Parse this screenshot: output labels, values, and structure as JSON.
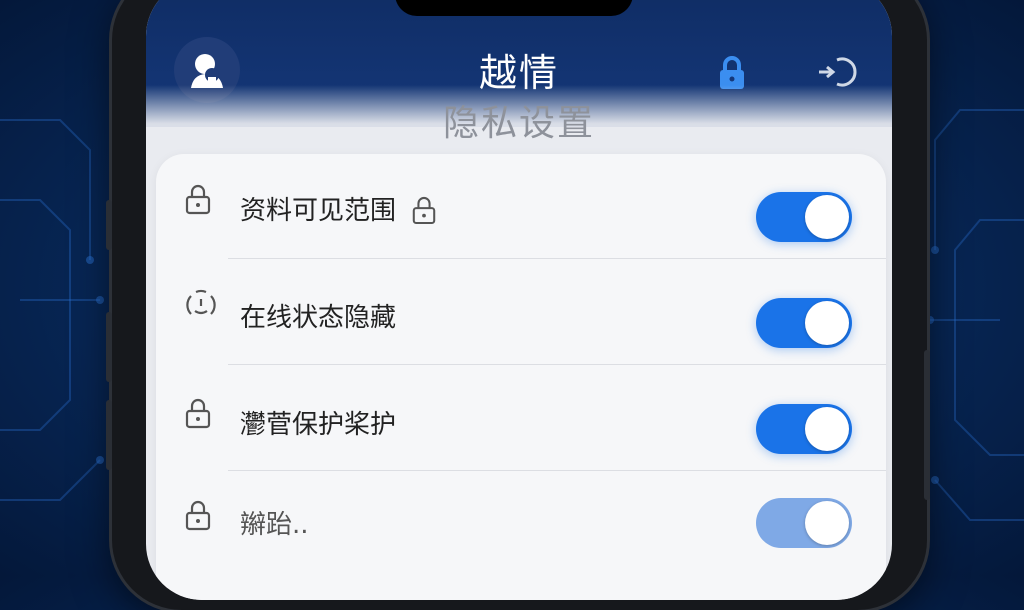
{
  "header": {
    "title": "越情",
    "subtitle": "隐私设置",
    "avatar_icon": "user-avatar-icon",
    "lock_icon": "lock-icon",
    "back_icon": "back-icon"
  },
  "settings": {
    "items": [
      {
        "label": "资料可见范围",
        "icon": "lock-icon",
        "trailing_icon": "lock-icon",
        "enabled": true
      },
      {
        "label": "在线状态隐藏",
        "icon": "face-icon",
        "enabled": true
      },
      {
        "label": "灪菅保护桨护",
        "icon": "lock-icon",
        "enabled": true
      },
      {
        "label": "辮跆..",
        "icon": "lock-icon",
        "enabled": true
      }
    ]
  },
  "colors": {
    "accent": "#1a73e8",
    "header_bg": "#0f2c63",
    "background": "#082a5c"
  }
}
